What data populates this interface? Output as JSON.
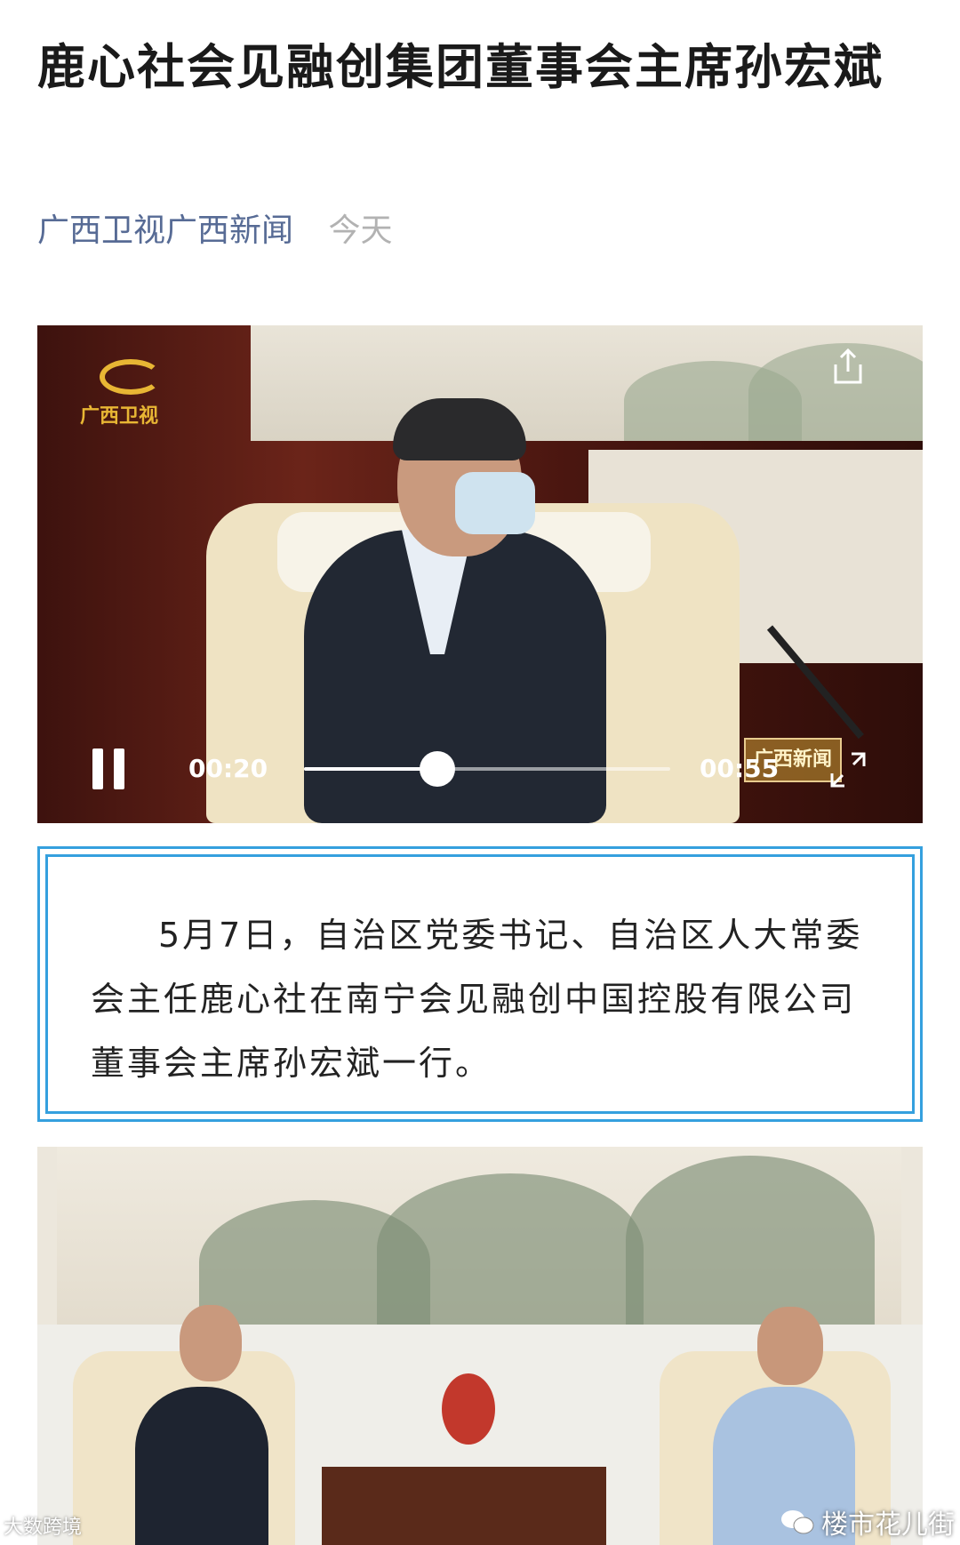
{
  "article": {
    "title": "鹿心社会见融创集团董事会主席孙宏斌",
    "source": "广西卫视广西新闻",
    "date": "今天"
  },
  "video": {
    "channel_logo_text": "广西卫视",
    "news_watermark_text": "广西新闻",
    "current_time": "00:20",
    "total_time": "00:55",
    "progress": 0.364
  },
  "body": {
    "paragraph": "5月7日，自治区党委书记、自治区人大常委会主任鹿心社在南宁会见融创中国控股有限公司董事会主席孙宏斌一行。"
  },
  "watermarks": {
    "left": "大数跨境",
    "right": "楼市花儿街"
  },
  "colors": {
    "source_link": "#576b95",
    "box_border": "#35a0de"
  }
}
